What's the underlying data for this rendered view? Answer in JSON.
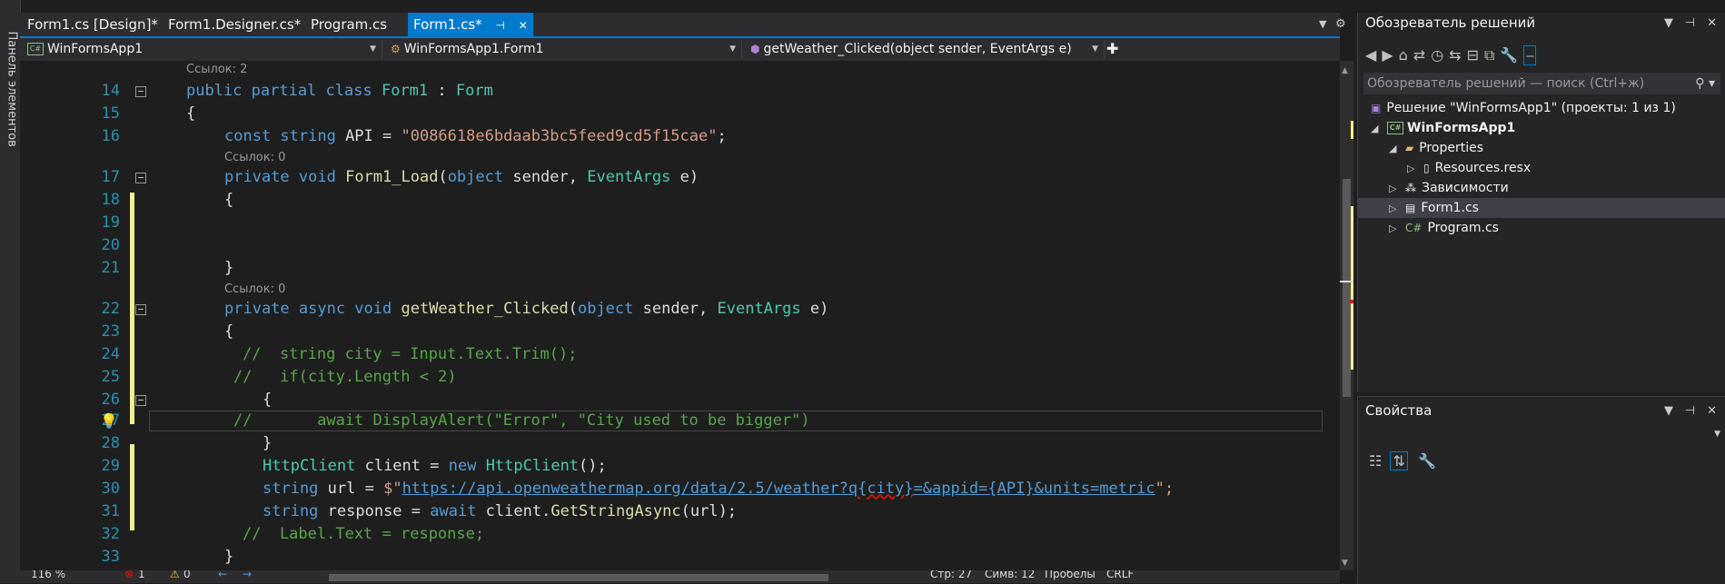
{
  "toolbox": {
    "label": "Панель элементов"
  },
  "tabs": [
    {
      "label": "Form1.cs [Design]*"
    },
    {
      "label": "Form1.Designer.cs*"
    },
    {
      "label": "Program.cs"
    },
    {
      "label": "Form1.cs*",
      "active": true
    }
  ],
  "tab_icons": {
    "pin": "pin-icon",
    "close": "close-icon",
    "overflow": "chevron-down-icon",
    "settings": "gear-icon"
  },
  "navbar": {
    "project": "WinFormsApp1",
    "class": "WinFormsApp1.Form1",
    "member": "getWeather_Clicked(object sender, EventArgs e)"
  },
  "refs": {
    "r1": "Ссылок: 2",
    "r2": "Ссылок: 0",
    "r3": "Ссылок: 0"
  },
  "code": {
    "n14": "14",
    "n15": "15",
    "n16": "16",
    "n17": "17",
    "n18": "18",
    "n19": "19",
    "n20": "20",
    "n21": "21",
    "n22": "22",
    "n23": "23",
    "n24": "24",
    "n25": "25",
    "n26": "26",
    "n27": "27",
    "n28": "28",
    "n29": "29",
    "n30": "30",
    "n31": "31",
    "n32": "32",
    "n33": "33",
    "l14_kw": "public partial class",
    "l14_name": "Form1",
    "l14_colon": " : ",
    "l14_base": "Form",
    "l15": "{",
    "l16_kw": "const string",
    "l16_id": " API = ",
    "l16_str": "\"0086618e6bdaab3bc5feed9cd5f15cae\"",
    "l16_end": ";",
    "l17_kw": "private void",
    "l17_fn": "Form1_Load",
    "l17_p1": "(",
    "l17_kw2": "object",
    "l17_p2": " sender, ",
    "l17_ty": "EventArgs",
    "l17_p3": " e)",
    "l18": "{",
    "l21": "}",
    "l22_kw": "private async void",
    "l22_fn": "getWeather_Clicked",
    "l22_p1": "(",
    "l22_kw2": "object",
    "l22_p2": " sender, ",
    "l22_ty": "EventArgs",
    "l22_p3": " e)",
    "l23": "{",
    "l24": "//  string city = Input.Text.Trim();",
    "l25": "//   if(city.Length < 2)",
    "l26": "{",
    "l27": "//       await DisplayAlert(\"Error\", \"City used to be bigger\")",
    "l28": "}",
    "l29_ty": "HttpClient",
    "l29_id": " client = ",
    "l29_kw": "new",
    "l29_ty2": "HttpClient",
    "l29_end": "();",
    "l30_kw": "string",
    "l30_id": " url = ",
    "l30_str1": "$\"",
    "l30_url1": "https://api.openweathermap.org/data/2.5/weather?q",
    "l30_ph1": "{city}",
    "l30_url2": "=&appid=",
    "l30_ph2": "{API}",
    "l30_url3": "&units=metric",
    "l30_str2": "\";",
    "l31_kw": "string",
    "l31_id": " response = ",
    "l31_kw2": "await",
    "l31_id2": " client.",
    "l31_fn": "GetStringAsync",
    "l31_end": "(url);",
    "l32": "//  Label.Text = response;",
    "l33": "}"
  },
  "status": {
    "zoom": "116 %",
    "errors": "1",
    "warnings": "0",
    "line": "Стр: 27",
    "col": "Симв: 12",
    "spaces": "Пробелы",
    "crlf": "CRLF"
  },
  "solution_explorer": {
    "title": "Обозреватель решений",
    "search_placeholder": "Обозреватель решений — поиск (Ctrl+ж)",
    "solution": "Решение \"WinFormsApp1\" (проекты: 1 из 1)",
    "project": "WinFormsApp1",
    "properties": "Properties",
    "resources": "Resources.resx",
    "dependencies": "Зависимости",
    "form1": "Form1.cs",
    "program": "Program.cs"
  },
  "properties_panel": {
    "title": "Свойства"
  },
  "colors": {
    "accent": "#007acc",
    "keyword": "#569cd6",
    "type": "#4ec9b0",
    "string": "#d69d85",
    "comment": "#57a64a",
    "method": "#dcdcaa",
    "line_number": "#2b91af"
  }
}
